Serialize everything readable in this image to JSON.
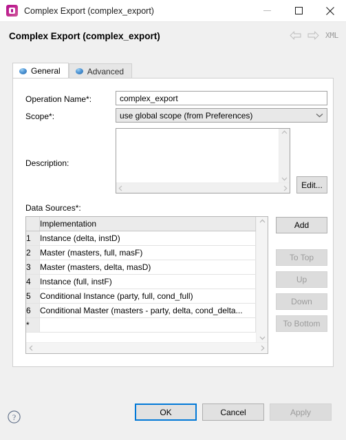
{
  "window": {
    "title": "Complex Export (complex_export)",
    "icon": "app-icon",
    "controls": {
      "minimize": "minimize-icon",
      "maximize": "maximize-icon",
      "close": "close-icon"
    }
  },
  "header": {
    "title": "Complex Export (complex_export)",
    "back": "back-arrow-icon",
    "forward": "forward-arrow-icon",
    "xml_label": "XML"
  },
  "tabs": [
    {
      "label": "General",
      "active": true
    },
    {
      "label": "Advanced",
      "active": false
    }
  ],
  "form": {
    "operation_name": {
      "label": "Operation Name*:",
      "value": "complex_export",
      "placeholder": ""
    },
    "scope": {
      "label": "Scope*:",
      "value": "use global scope (from Preferences)"
    },
    "description": {
      "label": "Description:",
      "value": "",
      "edit_label": "Edit..."
    },
    "data_sources": {
      "label": "Data Sources*:",
      "columns": [
        "",
        "Implementation"
      ],
      "rows": [
        {
          "num": "1",
          "implementation": "Instance (delta, instD)"
        },
        {
          "num": "2",
          "implementation": "Master (masters, full, masF)"
        },
        {
          "num": "3",
          "implementation": "Master (masters, delta, masD)"
        },
        {
          "num": "4",
          "implementation": "Instance (full, instF)"
        },
        {
          "num": "5",
          "implementation": "Conditional Instance (party, full, cond_full)"
        },
        {
          "num": "6",
          "implementation": "Conditional Master (masters - party, delta, cond_delta..."
        },
        {
          "num": "*",
          "implementation": ""
        }
      ],
      "buttons": [
        {
          "label": "Add",
          "enabled": true
        },
        {
          "label": "To Top",
          "enabled": false
        },
        {
          "label": "Up",
          "enabled": false
        },
        {
          "label": "Down",
          "enabled": false
        },
        {
          "label": "To Bottom",
          "enabled": false
        }
      ]
    }
  },
  "footer": {
    "help": "help-icon",
    "ok": "OK",
    "cancel": "Cancel",
    "apply": "Apply"
  },
  "colors": {
    "accent": "#0078d7",
    "dialog_bg": "#f0f0f0",
    "panel_bg": "#ffffff",
    "disabled_text": "#9b9b9b"
  }
}
